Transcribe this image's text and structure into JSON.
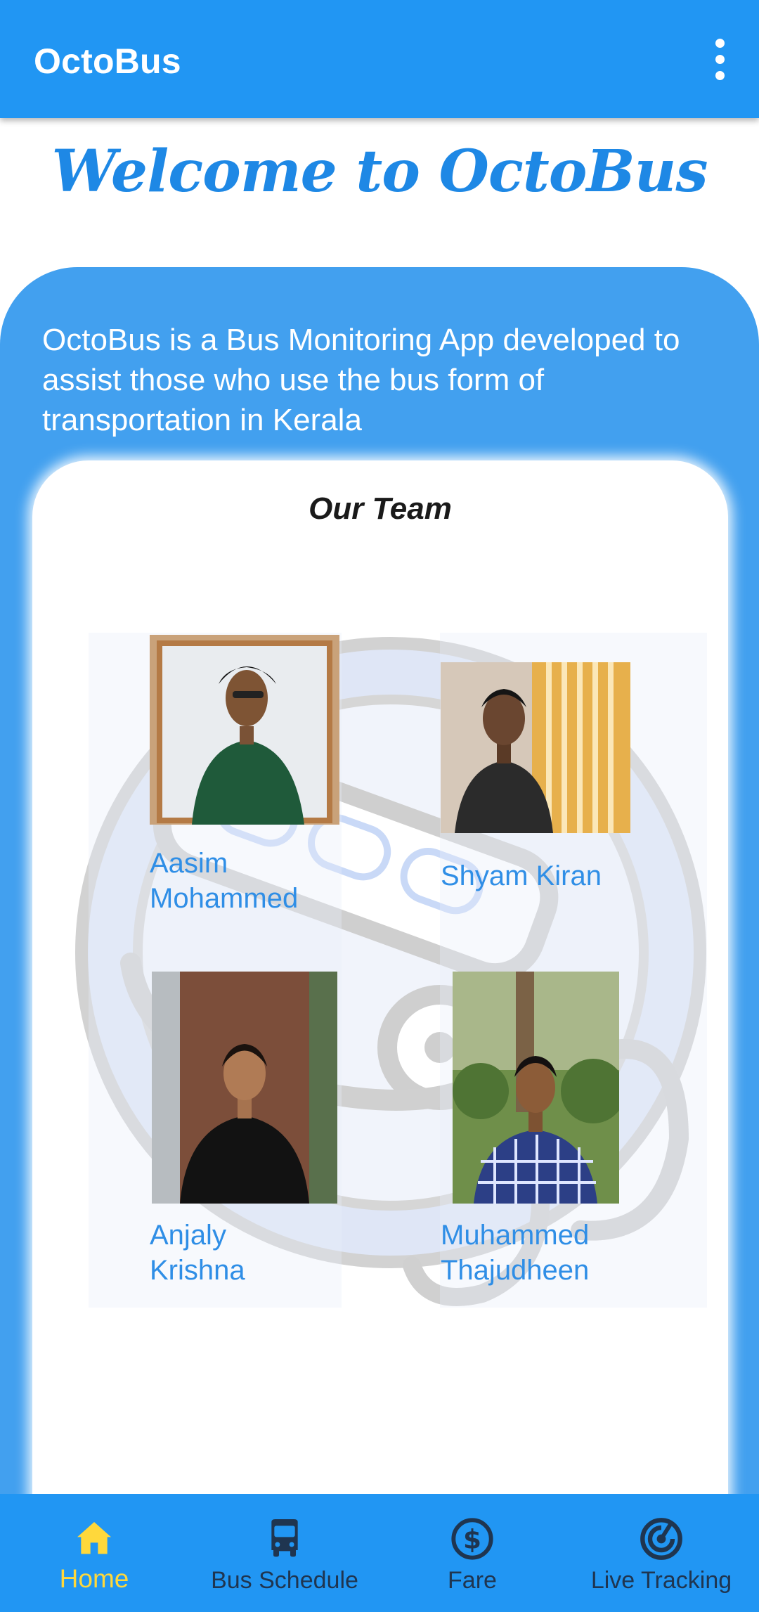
{
  "app_bar": {
    "title": "OctoBus",
    "menu_icon": "more-vert-icon"
  },
  "welcome": "Welcome to OctoBus",
  "intro": "OctoBus is a Bus Monitoring App developed to assist those who use the bus form of transportation in Kerala",
  "team": {
    "title": "Our Team",
    "members": [
      {
        "name": "Aasim\nMohammed"
      },
      {
        "name": "Shyam Kiran"
      },
      {
        "name": "Anjaly\nKrishna"
      },
      {
        "name": "Muhammed\nThajudheen"
      }
    ]
  },
  "bottom_nav": {
    "items": [
      {
        "label": "Home",
        "icon": "home-icon",
        "active": true
      },
      {
        "label": "Bus Schedule",
        "icon": "bus-icon",
        "active": false
      },
      {
        "label": "Fare",
        "icon": "dollar-icon",
        "active": false
      },
      {
        "label": "Live Tracking",
        "icon": "radar-icon",
        "active": false
      }
    ]
  },
  "colors": {
    "primary": "#2196F3",
    "panel": "#42A0EF",
    "active_nav": "#FFD83B",
    "inactive_nav": "#1f3550",
    "welcome_text": "#1E88E5",
    "member_name": "#2F8EE6"
  }
}
